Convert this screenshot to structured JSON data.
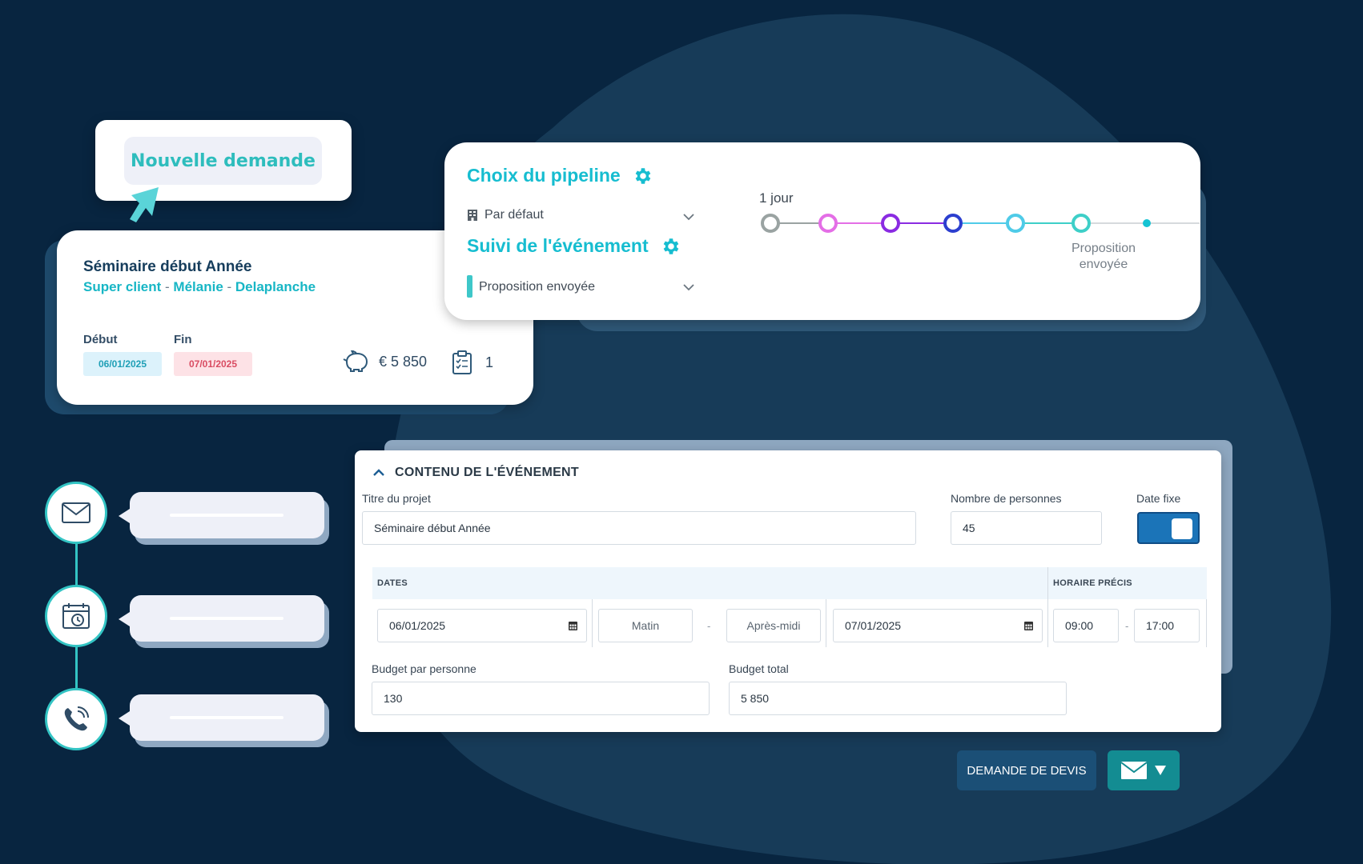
{
  "new_request": {
    "label": "Nouvelle demande"
  },
  "event_card": {
    "title": "Séminaire début Année",
    "client": "Super client",
    "contact_first": "Mélanie",
    "contact_last": "Delaplanche",
    "start_label": "Début",
    "end_label": "Fin",
    "start_date": "06/01/2025",
    "end_date": "07/01/2025",
    "budget": "€ 5 850",
    "tasks_count": "1",
    "icons": [
      "piggy-bank-icon",
      "clipboard-list-icon"
    ]
  },
  "pipeline": {
    "choice_title": "Choix du pipeline",
    "choice_value": "Par défaut",
    "tracking_title": "Suivi de l'événement",
    "tracking_value": "Proposition envoyée",
    "timeline_label": "1 jour",
    "timeline_stage_label_1": "Proposition",
    "timeline_stage_label_2": "envoyée",
    "stage_colors": [
      "#9aa3a2",
      "#e46ee6",
      "#8a2be2",
      "#2c3fcf",
      "#4fcbe8",
      "#3ecfc8",
      "#15c3d3"
    ]
  },
  "channels": {
    "icons": [
      "mail-icon",
      "calendar-clock-icon",
      "phone-call-icon"
    ]
  },
  "form": {
    "section_title": "CONTENU DE L'ÉVÉNEMENT",
    "project_title_label": "Titre du projet",
    "project_title_value": "Séminaire début Année",
    "people_label": "Nombre de personnes",
    "people_value": "45",
    "fixed_date_label": "Date fixe",
    "dates_header": "DATES",
    "time_header": "HORAIRE PRÉCIS",
    "start_date": "06/01/2025",
    "start_period": "Matin",
    "end_period": "Après-midi",
    "end_date": "07/01/2025",
    "start_time": "09:00",
    "end_time": "17:00",
    "budget_pp_label": "Budget par personne",
    "budget_pp_value": "130",
    "budget_total_label": "Budget total",
    "budget_total_value": "5 850",
    "separator": "-"
  },
  "actions": {
    "quote_request": "DEMANDE DE DEVIS"
  },
  "colors": {
    "background": "#082540",
    "accent": "#16bdd0",
    "primary": "#1b4f76",
    "mail_button": "#138c92"
  }
}
